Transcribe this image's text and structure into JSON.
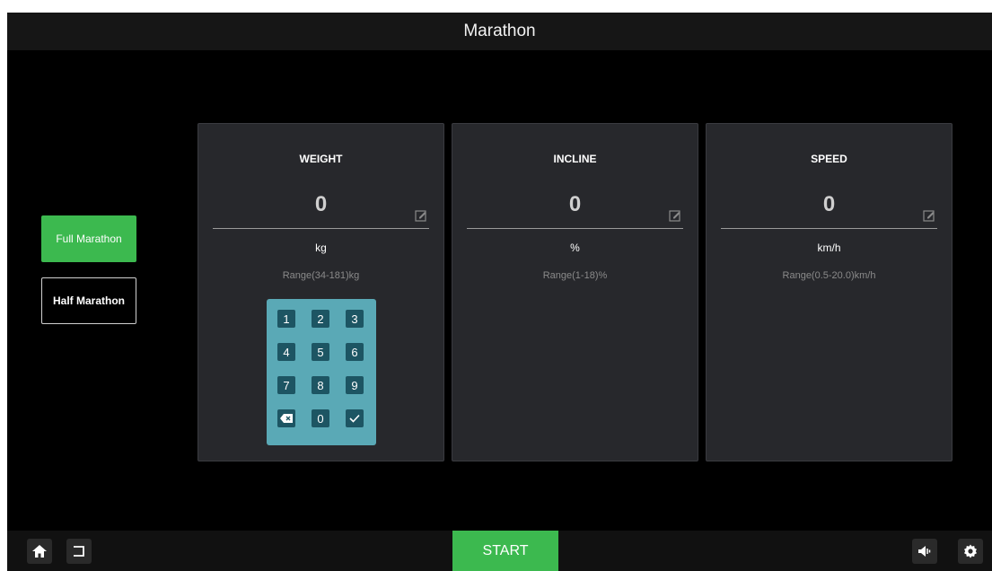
{
  "header": {
    "title": "Marathon"
  },
  "modes": [
    {
      "label": "Full Marathon",
      "active": true
    },
    {
      "label": "Half Marathon",
      "active": false
    }
  ],
  "panels": [
    {
      "title": "WEIGHT",
      "value": "0",
      "unit": "kg",
      "range": "Range(34-181)kg"
    },
    {
      "title": "INCLINE",
      "value": "0",
      "unit": "%",
      "range": "Range(1-18)%"
    },
    {
      "title": "SPEED",
      "value": "0",
      "unit": "km/h",
      "range": "Range(0.5-20.0)km/h"
    }
  ],
  "keypad": {
    "keys": [
      "1",
      "2",
      "3",
      "4",
      "5",
      "6",
      "7",
      "8",
      "9",
      "0"
    ],
    "backspace_icon": "backspace-icon",
    "confirm_icon": "checkmark-icon"
  },
  "footer": {
    "start_label": "START",
    "icons": [
      "home-icon",
      "back-icon",
      "volume-icon",
      "settings-icon"
    ]
  },
  "colors": {
    "accent_green": "#3cb94f",
    "panel_bg": "#27282c",
    "keypad_bg": "#5aa9b6",
    "key_bg": "#1d5563"
  }
}
